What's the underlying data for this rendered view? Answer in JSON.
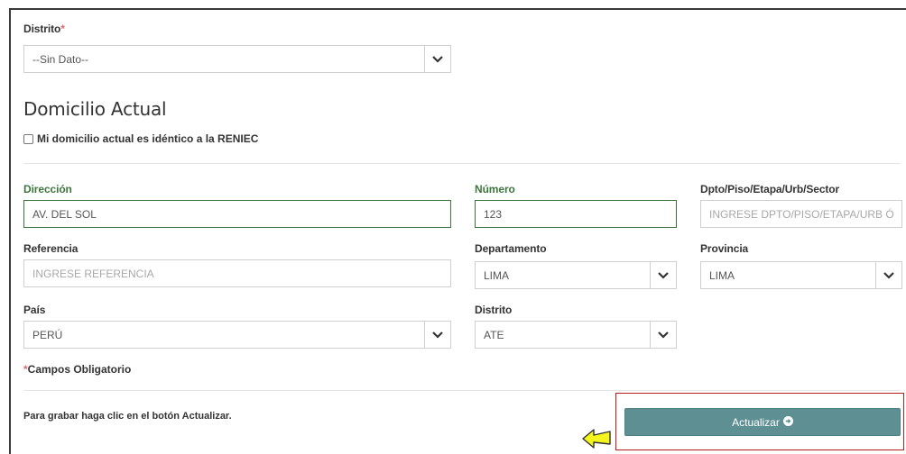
{
  "distrito_top": {
    "label": "Distrito",
    "required": "*",
    "value": "--Sin Dato--"
  },
  "section_title": "Domicilio Actual",
  "same_as_reniec": {
    "label": "Mi domicilio actual es idéntico a la RENIEC",
    "checked": false
  },
  "direccion": {
    "label": "Dirección",
    "value": "AV. DEL SOL"
  },
  "numero": {
    "label": "Número",
    "value": "123"
  },
  "dpto": {
    "label": "Dpto/Piso/Etapa/Urb/Sector",
    "placeholder": "INGRESE DPTO/PISO/ETAPA/URB Ó"
  },
  "referencia": {
    "label": "Referencia",
    "placeholder": "INGRESE REFERENCIA"
  },
  "departamento": {
    "label": "Departamento",
    "value": "LIMA"
  },
  "provincia": {
    "label": "Provincia",
    "value": "LIMA"
  },
  "pais": {
    "label": "País",
    "value": "PERÚ"
  },
  "distrito": {
    "label": "Distrito",
    "value": "ATE"
  },
  "required_note": {
    "mark": "*",
    "text": "Campos Obligatorio"
  },
  "save_hint": "Para grabar haga clic en el botón Actualizar.",
  "submit": {
    "label": "Actualizar",
    "icon": "arrow-circle-right-icon"
  },
  "colors": {
    "valid": "#3c763d",
    "button": "#5e8f92",
    "highlight": "#b01e1e",
    "pointer": "#f5f51e"
  }
}
